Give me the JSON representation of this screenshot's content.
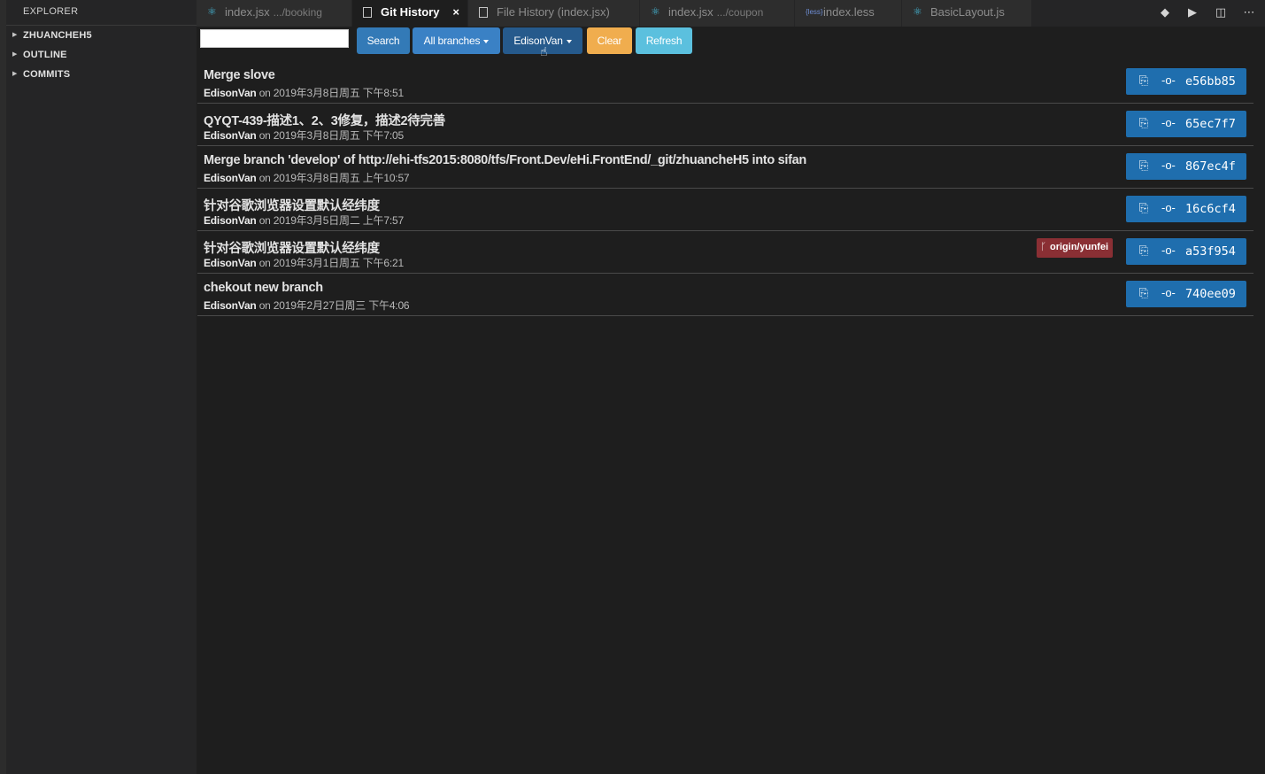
{
  "sidebar": {
    "title": "EXPLORER",
    "sections": [
      {
        "label": "ZHUANCHEH5"
      },
      {
        "label": "OUTLINE"
      },
      {
        "label": "COMMITS"
      }
    ]
  },
  "tabs": [
    {
      "label": "index.jsx",
      "hint": ".../booking",
      "icon": "react-icon"
    },
    {
      "label": "Git History",
      "hint": "",
      "icon": "file-icon",
      "active": true,
      "close": "×"
    },
    {
      "label": "File History (index.jsx)",
      "hint": "",
      "icon": "file-icon"
    },
    {
      "label": "index.jsx",
      "hint": ".../coupon",
      "icon": "react-icon"
    },
    {
      "label": "index.less",
      "hint": "",
      "icon": "less-icon"
    },
    {
      "label": "BasicLayout.js",
      "hint": "",
      "icon": "react-icon"
    }
  ],
  "toolbar": {
    "search_value": "",
    "search_label": "Search",
    "branches_label": "All branches",
    "author_label": "EdisonVan",
    "clear_label": "Clear",
    "refresh_label": "Refresh"
  },
  "commits": [
    {
      "subject": "Merge slove",
      "author": "EdisonVan",
      "date": "on 2019年3月8日周五 下午8:51",
      "hash": "e56bb85"
    },
    {
      "subject": "QYQT-439-描述1、2、3修复，描述2待完善",
      "author": "EdisonVan",
      "date": "on 2019年3月8日周五 下午7:05",
      "hash": "65ec7f7"
    },
    {
      "subject": "Merge branch 'develop' of http://ehi-tfs2015:8080/tfs/Front.Dev/eHi.FrontEnd/_git/zhuancheH5 into sifan",
      "author": "EdisonVan",
      "date": "on 2019年3月8日周五 上午10:57",
      "hash": "867ec4f"
    },
    {
      "subject": "针对谷歌浏览器设置默认经纬度",
      "author": "EdisonVan",
      "date": "on 2019年3月5日周二 上午7:57",
      "hash": "16c6cf4"
    },
    {
      "subject": "针对谷歌浏览器设置默认经纬度",
      "author": "EdisonVan",
      "date": "on 2019年3月1日周五 下午6:21",
      "hash": "a53f954",
      "branch": "origin/yunfei"
    },
    {
      "subject": "chekout new branch",
      "author": "EdisonVan",
      "date": "on 2019年2月27日周三 下午4:06",
      "hash": "740ee09"
    }
  ],
  "colors": {
    "background": "#1e1e1e",
    "sidebar": "#252526",
    "search_button": "#337ab7",
    "branches_button": "#3a81c5",
    "author_button": "#265a8c",
    "clear_button": "#f0ad4e",
    "refresh_button": "#5bc0de",
    "hash_button": "#1f6eae",
    "branch_badge": "#8a2f34"
  }
}
